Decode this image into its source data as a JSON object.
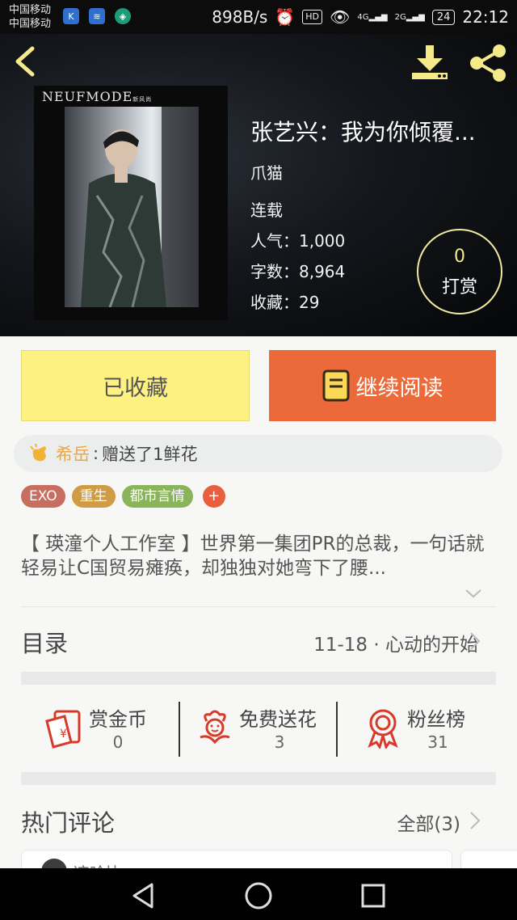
{
  "status_bar": {
    "carrier1": "中国移动",
    "carrier2": "中国移动",
    "net_speed": "898B/s",
    "hd": "HD",
    "net_4g": "4G",
    "net_2g": "2G",
    "battery": "24",
    "time": "22:12"
  },
  "book": {
    "cover_brand": "NEUFMODE",
    "cover_brand_small": "新风尚",
    "title": "张艺兴：我为你倾覆...",
    "author": "爪猫",
    "status": "连载",
    "popularity_label": "人气：",
    "popularity": "1,000",
    "wordcount_label": "字数：",
    "wordcount": "8,964",
    "favorites_label": "收藏：",
    "favorites": "29",
    "tip_count": "0",
    "tip_label": "打赏"
  },
  "actions": {
    "favorited_label": "已收藏",
    "continue_label": "继续阅读"
  },
  "gift": {
    "user": "希岳",
    "colon": ":",
    "text": "赠送了1鲜花"
  },
  "tags": [
    {
      "label": "EXO",
      "color": "#c86e60"
    },
    {
      "label": "重生",
      "color": "#cf9b45"
    },
    {
      "label": "都市言情",
      "color": "#8ab45a"
    }
  ],
  "tag_add": "+",
  "description": "【 瑛潼个人工作室 】世界第一集团PR的总裁，一句话就轻易让C国贸易瘫痪，却独独对她弯下了腰...",
  "toc": {
    "title": "目录",
    "latest": "11-18 · 心动的开始"
  },
  "stats": [
    {
      "label": "赏金币",
      "value": "0",
      "icon": "red-envelope-icon"
    },
    {
      "label": "免费送花",
      "value": "3",
      "icon": "flower-icon"
    },
    {
      "label": "粉丝榜",
      "value": "31",
      "icon": "ribbon-medal-icon"
    }
  ],
  "hot_comments": {
    "title": "热门评论",
    "all_label": "全部(3)",
    "first_user_partial": "凉哈比"
  },
  "colors": {
    "accent_orange": "#ec6a39",
    "accent_yellow": "#fdf182",
    "icon_red": "#d83a2a"
  }
}
